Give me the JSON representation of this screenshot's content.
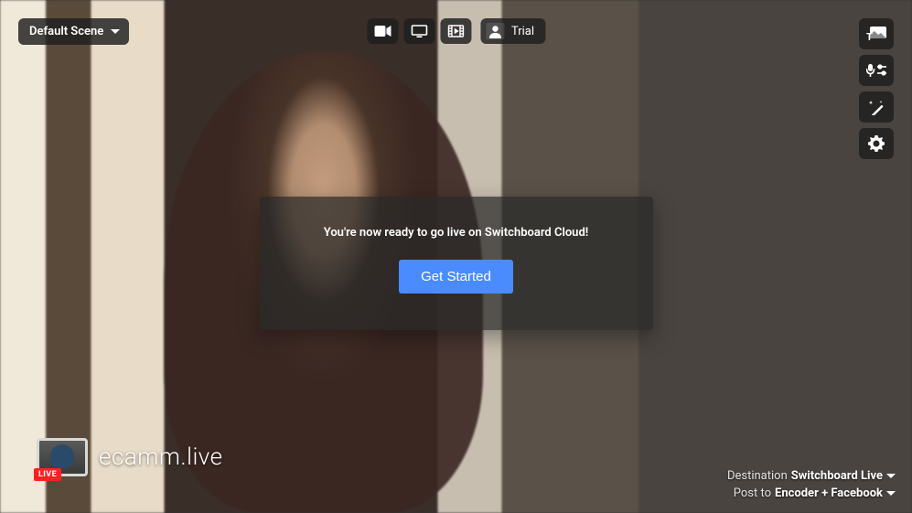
{
  "scene": {
    "selected": "Default Scene"
  },
  "topToolbar": {
    "account_label": "Trial"
  },
  "modal": {
    "message": "You're now ready to go live on Switchboard Cloud!",
    "button": "Get Started"
  },
  "watermark": {
    "live_badge": "LIVE",
    "brand": "ecamm.live"
  },
  "destination": {
    "label": "Destination",
    "value": "Switchboard Live"
  },
  "postTo": {
    "label": "Post to",
    "value": "Encoder + Facebook"
  }
}
